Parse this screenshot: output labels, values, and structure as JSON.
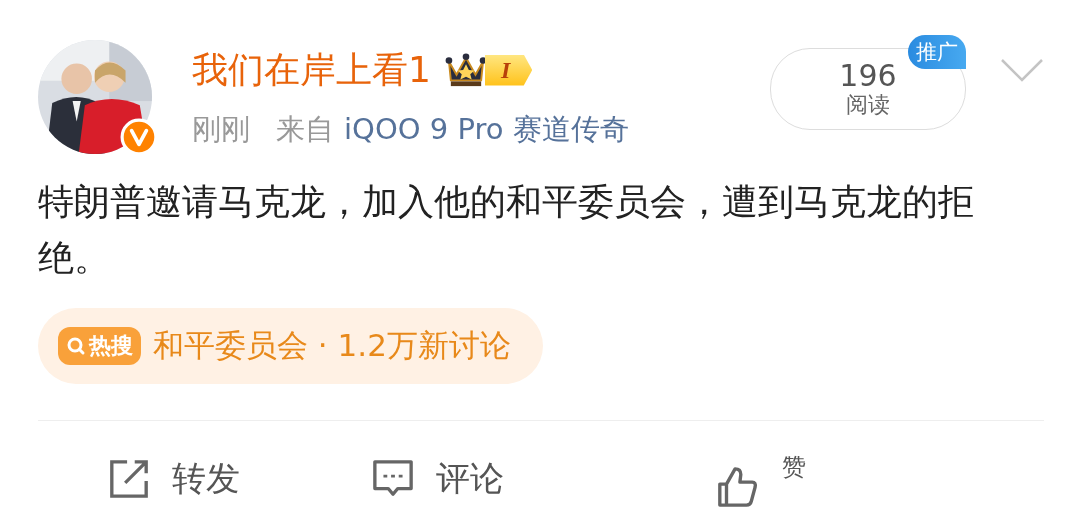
{
  "post": {
    "author": "我们在岸上看1",
    "verified": true,
    "level_badge": "I",
    "time": "刚刚",
    "source_prefix": "来自",
    "source": "iQOO 9 Pro 赛道传奇",
    "views": "196",
    "views_label": "阅读",
    "promo_badge": "推广",
    "text": "特朗普邀请马克龙，加入他的和平委员会，遭到马克龙的拒绝。",
    "hot_search": {
      "label": "热搜",
      "topic": "和平委员会 · 1.2万新讨论"
    }
  },
  "actions": [
    {
      "kind": "repost",
      "label": "转发"
    },
    {
      "kind": "comment",
      "label": "评论"
    },
    {
      "kind": "like",
      "label": "赞"
    }
  ]
}
